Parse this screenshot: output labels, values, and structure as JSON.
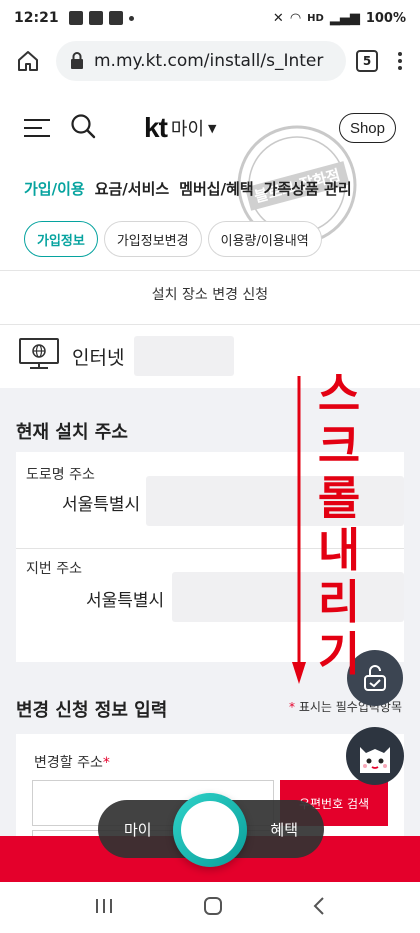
{
  "status_bar": {
    "time": "12:21",
    "battery": "100%",
    "network": "HD"
  },
  "browser": {
    "url": "m.my.kt.com/install/s_Inter",
    "tab_count": "5"
  },
  "header": {
    "logo_text": "kt",
    "logo_suffix": "마이",
    "shop_label": "Shop"
  },
  "gnb": [
    "가입/이용",
    "요금/서비스",
    "멤버십/혜택",
    "가족상품 관리"
  ],
  "chips": [
    "가입정보",
    "가입정보변경",
    "이용량/이용내역"
  ],
  "page_title": "설치 장소 변경 신청",
  "service": {
    "name": "인터넷"
  },
  "current_address": {
    "title": "현재 설치 주소",
    "road_label": "도로명 주소",
    "road_value": "서울특별시",
    "lot_label": "지번 주소",
    "lot_value": "서울특별시"
  },
  "change_form": {
    "title": "변경 신청 정보 입력",
    "required_note": "표시는 필수입력항목",
    "required_star": "*",
    "address_label": "변경할 주소",
    "zip_button": "우편번호 검색"
  },
  "float_nav": {
    "left_label": "마이",
    "right_label": "혜택"
  },
  "annotation": {
    "chars": [
      "스",
      "크",
      "롤",
      "내",
      "리",
      "기"
    ]
  },
  "stamp": {
    "text": "블로그 잡화점"
  },
  "colors": {
    "kt_red": "#e4002b",
    "teal": "#06a39f",
    "annotation_red": "#e30012"
  }
}
